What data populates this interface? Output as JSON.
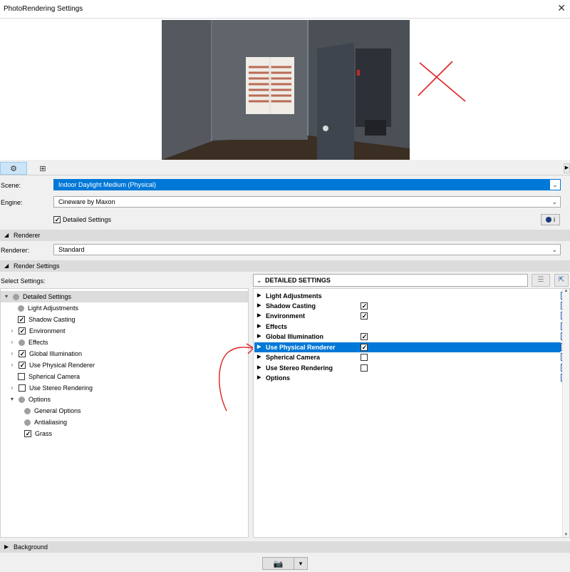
{
  "window": {
    "title": "PhotoRendering Settings",
    "close_glyph": "✕"
  },
  "toolbar": {
    "settings_icon": "gear-icon",
    "view_icon": "grid-icon"
  },
  "form": {
    "scene_label": "Scene:",
    "scene_value": "Indoor Daylight Medium (Physical)",
    "engine_label": "Engine:",
    "engine_value": "Cineware by Maxon",
    "detailed_settings_label": "Detailed Settings",
    "detailed_settings_checked": true,
    "info_glyph": "i"
  },
  "renderer_section": {
    "title": "Renderer",
    "renderer_label": "Renderer:",
    "renderer_value": "Standard"
  },
  "render_settings_section": {
    "title": "Render Settings",
    "select_label": "Select Settings:",
    "right_header": "DETAILED SETTINGS"
  },
  "tree": [
    {
      "label": "Detailed Settings",
      "kind": "dot",
      "expander": "▾"
    },
    {
      "label": "Light Adjustments",
      "kind": "dot",
      "expander": ""
    },
    {
      "label": "Shadow Casting",
      "kind": "check",
      "checked": true,
      "expander": ""
    },
    {
      "label": "Environment",
      "kind": "check",
      "checked": true,
      "expander": "›"
    },
    {
      "label": "Effects",
      "kind": "dot",
      "expander": "›"
    },
    {
      "label": "Global Illumination",
      "kind": "check",
      "checked": true,
      "expander": "›"
    },
    {
      "label": "Use Physical Renderer",
      "kind": "check",
      "checked": true,
      "expander": "›"
    },
    {
      "label": "Spherical Camera",
      "kind": "check",
      "checked": false,
      "expander": ""
    },
    {
      "label": "Use Stereo Rendering",
      "kind": "check",
      "checked": false,
      "expander": "›"
    },
    {
      "label": "Options",
      "kind": "dot",
      "expander": "▾"
    },
    {
      "label": "General Options",
      "kind": "dot",
      "expander": ""
    },
    {
      "label": "Antialiasing",
      "kind": "dot",
      "expander": ""
    },
    {
      "label": "Grass",
      "kind": "check",
      "checked": true,
      "expander": ""
    }
  ],
  "right_rows": [
    {
      "label": "Light Adjustments",
      "has_check": false,
      "checked": false
    },
    {
      "label": "Shadow Casting",
      "has_check": true,
      "checked": true
    },
    {
      "label": "Environment",
      "has_check": true,
      "checked": true
    },
    {
      "label": "Effects",
      "has_check": false,
      "checked": false
    },
    {
      "label": "Global Illumination",
      "has_check": true,
      "checked": true
    },
    {
      "label": "Use Physical Renderer",
      "has_check": true,
      "checked": true,
      "selected": true
    },
    {
      "label": "Spherical Camera",
      "has_check": true,
      "checked": false
    },
    {
      "label": "Use Stereo Rendering",
      "has_check": true,
      "checked": false
    },
    {
      "label": "Options",
      "has_check": false,
      "checked": false
    }
  ],
  "background_section": {
    "title": "Background"
  },
  "bottom": {
    "render_icon": "camera-icon",
    "dropdown_glyph": "▾"
  },
  "colors": {
    "selection": "#0078d7",
    "annotation_red": "#e02020"
  }
}
